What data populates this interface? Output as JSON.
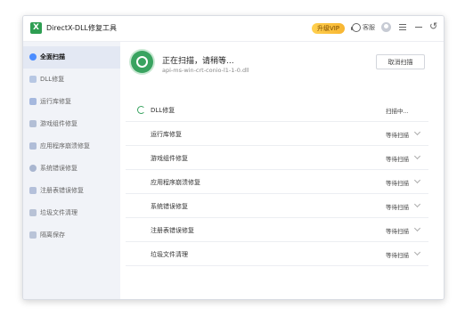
{
  "app": {
    "logo_glyph": "X",
    "title": "DirectX-DLL修复工具",
    "vip_label": "升级VIP",
    "help_label": "客服"
  },
  "sidebar": {
    "items": [
      {
        "label": "全面扫描",
        "icon": "scan-icon",
        "active": true
      },
      {
        "label": "DLL修复",
        "icon": "file-icon"
      },
      {
        "label": "运行库修复",
        "icon": "code-icon"
      },
      {
        "label": "游戏组件修复",
        "icon": "gamepad-icon"
      },
      {
        "label": "应用程序崩溃修复",
        "icon": "app-grid-icon"
      },
      {
        "label": "系统错误修复",
        "icon": "gear-icon"
      },
      {
        "label": "注册表错误修复",
        "icon": "registry-icon"
      },
      {
        "label": "垃圾文件清理",
        "icon": "trash-icon"
      },
      {
        "label": "隔离保存",
        "icon": "document-icon"
      }
    ]
  },
  "main": {
    "scan_title": "正在扫描，请稍等...",
    "current_file": "api-ms-win-crt-conio-l1-1-0.dll",
    "cancel_label": "取消扫描",
    "rows": [
      {
        "name": "DLL修复",
        "status": "扫描中...",
        "state": "scanning"
      },
      {
        "name": "运行库修复",
        "status": "等待扫描",
        "state": "waiting"
      },
      {
        "name": "游戏组件修复",
        "status": "等待扫描",
        "state": "waiting"
      },
      {
        "name": "应用程序崩溃修复",
        "status": "等待扫描",
        "state": "waiting"
      },
      {
        "name": "系统错误修复",
        "status": "等待扫描",
        "state": "waiting"
      },
      {
        "name": "注册表错误修复",
        "status": "等待扫描",
        "state": "waiting"
      },
      {
        "name": "垃圾文件清理",
        "status": "等待扫描",
        "state": "waiting"
      }
    ]
  },
  "colors": {
    "accent": "#39a360",
    "vip": "#f7b531"
  }
}
